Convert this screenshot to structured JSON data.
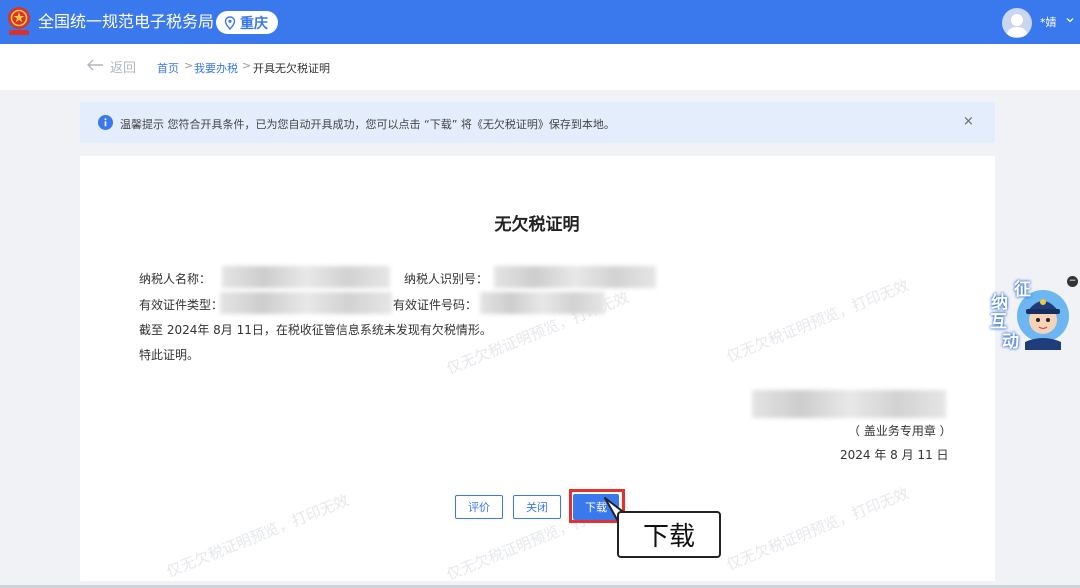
{
  "header": {
    "app_title": "全国统一规范电子税务局",
    "region": "重庆",
    "username": "*婧"
  },
  "nav": {
    "back_label": "返回",
    "breadcrumb": [
      "首页",
      "我要办税",
      "开具无欠税证明"
    ],
    "separator": ">"
  },
  "notice": {
    "text": "温馨提示 您符合开具条件，已为您自动开具成功，您可以点击 “下载” 将《无欠税证明》保存到本地。",
    "close": "×"
  },
  "certificate": {
    "title": "无欠税证明",
    "taxpayer_name_label": "纳税人名称：",
    "taxpayer_id_label": "纳税人识别号：",
    "id_type_label": "有效证件类型：",
    "id_number_label": "有效证件号码：",
    "statement": "截至 2024年 8月 11日，在税收征管信息系统未发现有欠税情形。",
    "closing": "特此证明。",
    "seal_note": "（ 盖业务专用章 ）",
    "issue_date": "2024 年 8 月 11 日",
    "watermark": "仅无欠税证明预览，打印无效"
  },
  "actions": {
    "rate": "评价",
    "close": "关闭",
    "download": "下载"
  },
  "callout": {
    "label": "下载"
  },
  "side_widget": {
    "chars": [
      "纳",
      "征",
      "互",
      "动"
    ],
    "close": "−"
  },
  "colors": {
    "brand_blue": "#3a78ee",
    "notice_bg": "#e3edfc",
    "highlight_red": "#e6302f"
  }
}
